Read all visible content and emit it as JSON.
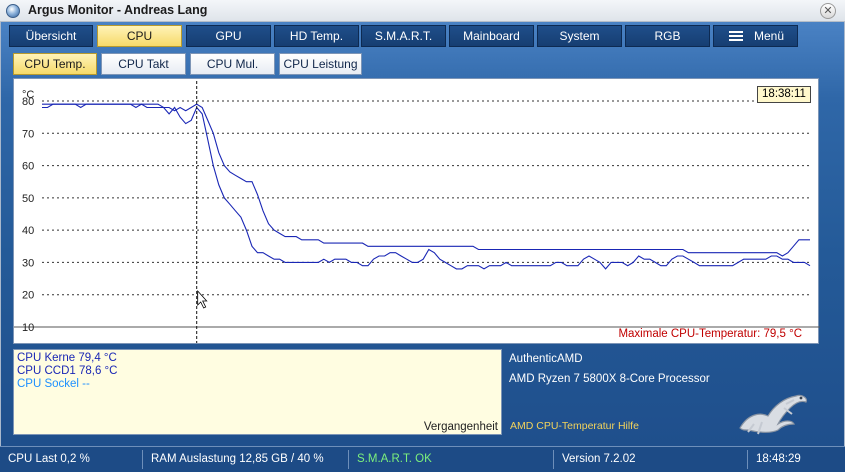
{
  "window": {
    "title": "Argus Monitor - Andreas Lang",
    "close_symbol": "✕"
  },
  "tabs": [
    {
      "label": "Übersicht",
      "active": false
    },
    {
      "label": "CPU",
      "active": true
    },
    {
      "label": "GPU",
      "active": false
    },
    {
      "label": "HD Temp.",
      "active": false
    },
    {
      "label": "S.M.A.R.T.",
      "active": false
    },
    {
      "label": "Mainboard",
      "active": false
    },
    {
      "label": "System",
      "active": false
    },
    {
      "label": "RGB",
      "active": false
    },
    {
      "label": "Menü",
      "active": false,
      "icon": "hamburger-menu-icon"
    }
  ],
  "subtabs": [
    {
      "label": "CPU Temp.",
      "active": true
    },
    {
      "label": "CPU Takt",
      "active": false
    },
    {
      "label": "CPU Mul.",
      "active": false
    },
    {
      "label": "CPU Leistung",
      "active": false
    }
  ],
  "chart_data": {
    "type": "line",
    "y_unit_label": "°C",
    "ylim": [
      10,
      80
    ],
    "y_ticks": [
      10,
      20,
      30,
      40,
      50,
      60,
      70,
      80
    ],
    "grid": true,
    "cursor_time": "18:38:11",
    "cursor_sample": 28,
    "max_label": "Maximale CPU-Temperatur: 79,5 °C",
    "colors": {
      "series": "#1a27b5",
      "grid": "#333333",
      "max_label": "#c00000"
    },
    "series": [
      {
        "name": "CPU Kerne",
        "values": [
          79,
          79,
          79,
          79,
          79,
          79,
          79,
          79,
          79,
          79,
          79,
          79,
          79,
          79,
          79,
          79,
          79,
          79,
          79,
          79,
          79,
          79,
          78,
          78,
          77,
          78,
          77,
          78,
          79,
          78,
          74,
          70,
          64,
          60,
          58,
          57,
          56,
          55,
          55,
          51,
          46,
          42,
          40,
          39,
          38,
          38,
          38,
          37,
          37,
          37,
          37,
          36,
          36,
          36,
          36,
          36,
          36,
          36,
          36,
          35,
          35,
          35,
          35,
          35,
          35,
          35,
          35,
          35,
          35,
          35,
          35,
          35,
          35,
          35,
          35,
          35,
          35,
          35,
          35,
          34,
          34,
          34,
          34,
          34,
          34,
          34,
          34,
          34,
          34,
          34,
          34,
          34,
          34,
          34,
          34,
          34,
          34,
          34,
          34,
          34,
          34,
          34,
          34,
          34,
          34,
          34,
          34,
          34,
          34,
          34,
          34,
          34,
          34,
          34,
          34,
          34,
          34,
          33,
          33,
          33,
          33,
          33,
          33,
          33,
          33,
          33,
          33,
          33,
          33,
          33,
          33,
          33,
          33,
          33,
          32,
          33,
          35,
          37,
          37,
          37
        ]
      },
      {
        "name": "CPU CCD1",
        "values": [
          78,
          78,
          79,
          79,
          79,
          79,
          79,
          78,
          79,
          79,
          79,
          79,
          79,
          79,
          79,
          79,
          79,
          78,
          79,
          78,
          78,
          78,
          78,
          76,
          78,
          75,
          73,
          74,
          78,
          76,
          68,
          60,
          54,
          50,
          48,
          46,
          44,
          40,
          35,
          33,
          33,
          32,
          31,
          31,
          30,
          30,
          30,
          30,
          30,
          30,
          30,
          31,
          30,
          31,
          31,
          31,
          30,
          30,
          29,
          29,
          31,
          32,
          32,
          33,
          33,
          32,
          31,
          30,
          30,
          31,
          34,
          33,
          31,
          30,
          29,
          28,
          28,
          29,
          29,
          29,
          28,
          29,
          29,
          29,
          30,
          29,
          29,
          29,
          29,
          29,
          29,
          29,
          29,
          30,
          30,
          29,
          29,
          29,
          31,
          32,
          31,
          30,
          28,
          30,
          30,
          30,
          29,
          30,
          32,
          31,
          31,
          30,
          29,
          29,
          31,
          32,
          32,
          31,
          30,
          29,
          29,
          29,
          29,
          29,
          29,
          29,
          30,
          31,
          31,
          31,
          31,
          31,
          32,
          32,
          31,
          31,
          30,
          30,
          30,
          29
        ]
      }
    ]
  },
  "sensors": [
    {
      "label": "CPU Kerne 79,4 °C",
      "color": "#1a27b5"
    },
    {
      "label": "CPU CCD1 78,6 °C",
      "color": "#1a27b5"
    },
    {
      "label": "CPU Sockel --",
      "color": "#1e90ff"
    }
  ],
  "history_label": "Vergangenheit",
  "cpu_info": {
    "vendor": "AuthenticAMD",
    "model": "AMD Ryzen 7 5800X 8-Core Processor"
  },
  "help_link": "AMD CPU-Temperatur Hilfe",
  "status_bar": {
    "cpu_load": "CPU Last 0,2 %",
    "ram_load": "RAM Auslastung 12,85 GB / 40 %",
    "smart": "S.M.A.R.T. OK",
    "version": "Version 7.2.02",
    "time": "18:48:29",
    "smart_color": "#7cf07c"
  }
}
